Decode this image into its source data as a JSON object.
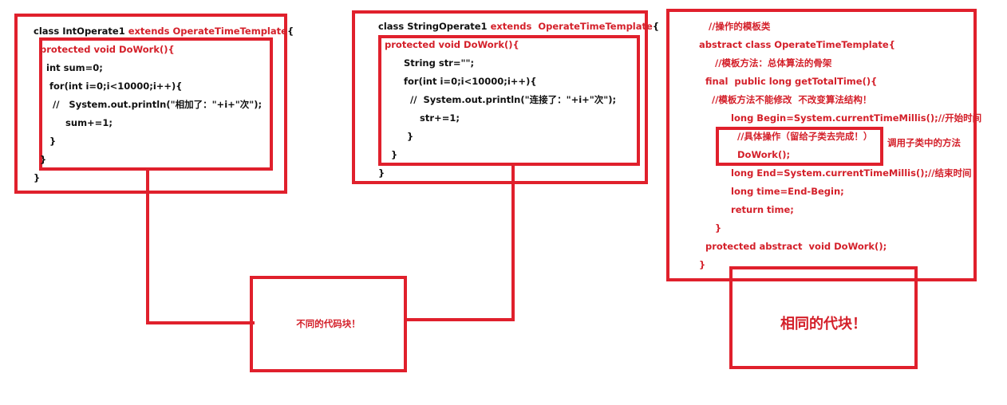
{
  "colors": {
    "accent": "#e0202c",
    "text": "#111111",
    "red_text": "#d4202a"
  },
  "int_block": {
    "header_class": "class IntOperate1 ",
    "header_extends": "extends OperateTimeTemplate",
    "header_brace": "{",
    "method_sig": "protected void DoWork(){",
    "lines": [
      "    int sum=0;",
      "     for(int i=0;i<10000;i++){",
      "      //   System.out.println(\"相加了：\"+i+\"次\");",
      "          sum+=1;",
      "     }",
      "  }"
    ],
    "closing": "}"
  },
  "string_block": {
    "header_class": "class StringOperate1 ",
    "header_extends": "extends  OperateTimeTemplate",
    "header_brace": "{",
    "method_sig": "protected void DoWork(){",
    "lines": [
      "        String str=\"\";",
      "        for(int i=0;i<10000;i++){",
      "          //  System.out.println(\"连接了：\"+i+\"次\");",
      "             str+=1;",
      "         }",
      "    }"
    ],
    "closing": "}"
  },
  "template_block": {
    "lines_top": [
      "   //操作的模板类",
      "abstract class OperateTimeTemplate{",
      "     //模板方法：总体算法的骨架",
      "  final  public long getTotalTime(){",
      "    //模板方法不能修改  不改变算法结构！",
      "          long Begin=System.currentTimeMillis();//开始时间"
    ],
    "inner_lines": [
      "  //具体操作（留给子类去完成！）",
      "  DoWork();"
    ],
    "inner_note": "调用子类中的方法",
    "lines_bottom": [
      "          long End=System.currentTimeMillis();//结束时间",
      "          long time=End-Begin;",
      "          return time;",
      "     }",
      "  protected abstract  void DoWork();",
      "}"
    ]
  },
  "label_different": "不同的代码块！",
  "label_same": "相同的代块！"
}
